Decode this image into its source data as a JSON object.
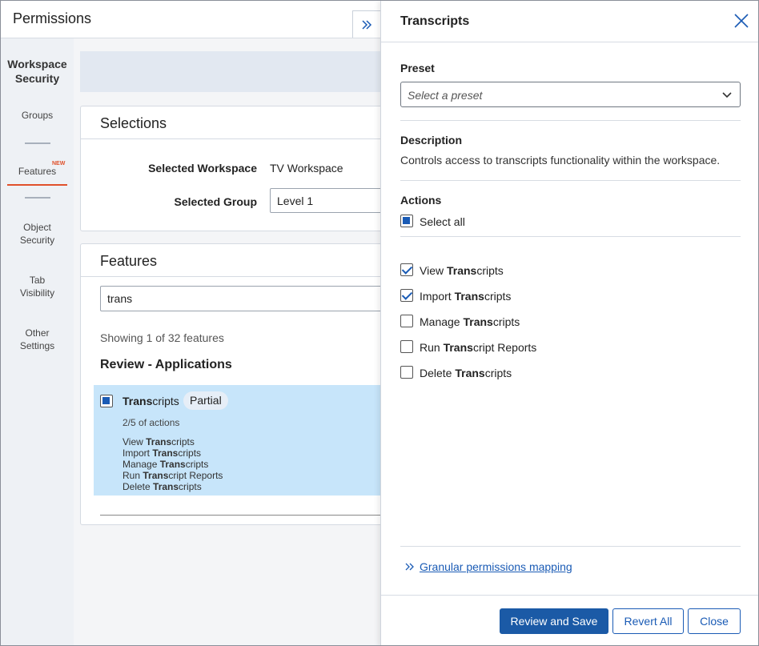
{
  "header": {
    "title": "Permissions"
  },
  "sidebar": {
    "heading": "Workspace Security",
    "items": [
      {
        "label": "Groups"
      },
      {
        "label": "Features",
        "badge": "NEW",
        "active": true
      },
      {
        "label": "Object Security"
      },
      {
        "label": "Tab Visibility"
      },
      {
        "label": "Other Settings"
      }
    ]
  },
  "selections": {
    "title": "Selections",
    "workspace_label": "Selected Workspace",
    "workspace_value": "TV Workspace",
    "group_label": "Selected Group",
    "group_value": "Level 1"
  },
  "features": {
    "title": "Features",
    "search_value": "trans",
    "showing": "Showing 1 of 32 features",
    "group_title": "Review - Applications",
    "item": {
      "name_bold": "Trans",
      "name_rest": "cripts",
      "status": "Partial",
      "count": "2/5 of actions",
      "actions": [
        {
          "pre": "View ",
          "bold": "Trans",
          "post": "cripts"
        },
        {
          "pre": "Import ",
          "bold": "Trans",
          "post": "cripts"
        },
        {
          "pre": "Manage ",
          "bold": "Trans",
          "post": "cripts"
        },
        {
          "pre": "Run ",
          "bold": "Trans",
          "post": "cript Reports"
        },
        {
          "pre": "Delete ",
          "bold": "Trans",
          "post": "cripts"
        }
      ]
    }
  },
  "panel": {
    "title": "Transcripts",
    "preset_label": "Preset",
    "preset_placeholder": "Select a preset",
    "description_label": "Description",
    "description_text": "Controls access to transcripts functionality within the workspace.",
    "actions_label": "Actions",
    "select_all": "Select all",
    "actions": [
      {
        "pre": "View ",
        "bold": "Trans",
        "post": "cripts",
        "checked": true
      },
      {
        "pre": "Import ",
        "bold": "Trans",
        "post": "cripts",
        "checked": true
      },
      {
        "pre": "Manage ",
        "bold": "Trans",
        "post": "cripts",
        "checked": false
      },
      {
        "pre": "Run ",
        "bold": "Trans",
        "post": "cript Reports",
        "checked": false
      },
      {
        "pre": "Delete ",
        "bold": "Trans",
        "post": "cripts",
        "checked": false
      }
    ],
    "link_text": "Granular permissions mapping"
  },
  "footer": {
    "review_save": "Review and Save",
    "revert_all": "Revert All",
    "close": "Close"
  },
  "colors": {
    "accent": "#1a5bb5",
    "primary_button": "#1b5aa6",
    "selected_row": "#c7e5fa",
    "active_indicator": "#e0512b"
  }
}
